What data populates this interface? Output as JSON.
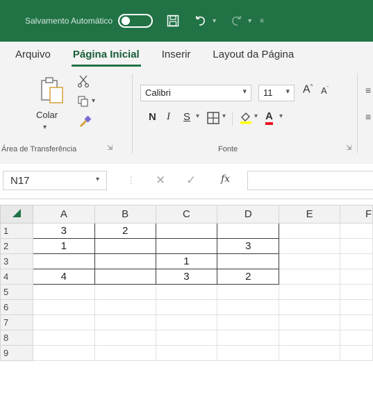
{
  "titlebar": {
    "autosave_label": "Salvamento Automático",
    "bg": "#217346"
  },
  "tabs": [
    {
      "label": "Arquivo",
      "active": false
    },
    {
      "label": "Página Inicial",
      "active": true
    },
    {
      "label": "Inserir",
      "active": false
    },
    {
      "label": "Layout da Página",
      "active": false
    }
  ],
  "ribbon": {
    "clipboard": {
      "paste_label": "Colar",
      "group_label": "Área de Transferência"
    },
    "font": {
      "font_name": "Calibri",
      "font_size": "11",
      "grow_label": "A",
      "shrink_label": "A",
      "bold_label": "N",
      "italic_label": "I",
      "underline_label": "S",
      "fontcolor_label": "A",
      "group_label": "Fonte"
    }
  },
  "formula_bar": {
    "name_box": "N17",
    "fx_label": "fx",
    "formula": ""
  },
  "grid": {
    "columns": [
      "A",
      "B",
      "C",
      "D",
      "E",
      "F"
    ],
    "rows": [
      {
        "num": "1",
        "cells": [
          "3",
          "2",
          "",
          "",
          "",
          ""
        ]
      },
      {
        "num": "2",
        "cells": [
          "1",
          "",
          "",
          "3",
          "",
          ""
        ]
      },
      {
        "num": "3",
        "cells": [
          "",
          "",
          "1",
          "",
          "",
          ""
        ]
      },
      {
        "num": "4",
        "cells": [
          "4",
          "",
          "3",
          "2",
          "",
          ""
        ]
      },
      {
        "num": "5",
        "cells": [
          "",
          "",
          "",
          "",
          "",
          ""
        ]
      },
      {
        "num": "6",
        "cells": [
          "",
          "",
          "",
          "",
          "",
          ""
        ]
      },
      {
        "num": "7",
        "cells": [
          "",
          "",
          "",
          "",
          "",
          ""
        ]
      },
      {
        "num": "8",
        "cells": [
          "",
          "",
          "",
          "",
          "",
          ""
        ]
      },
      {
        "num": "9",
        "cells": [
          "",
          "",
          "",
          "",
          "",
          ""
        ]
      }
    ]
  }
}
